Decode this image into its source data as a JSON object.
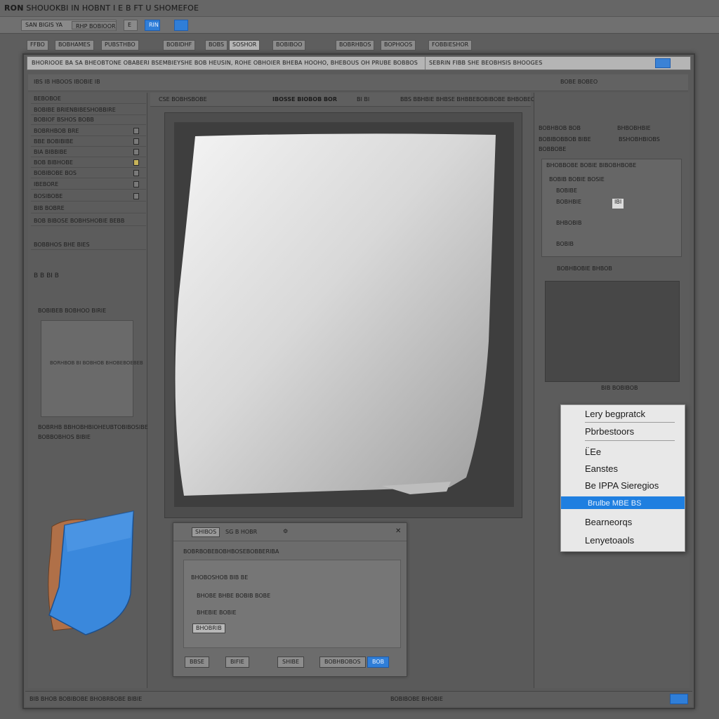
{
  "window": {
    "title_bold": "RON",
    "title_rest": "SHOUOKBI IN HOBNT I E B FT U SHOMEFOE",
    "menu_tabs": [
      "SAN BIGIS YA",
      "RHP BOBIOORE SHI",
      "E",
      "RIN",
      ""
    ]
  },
  "options_bar": {
    "buttons": [
      "FFBO",
      "BOBHAMES",
      "PUBSTHBO",
      "BOBIDHF",
      "BOBS",
      "SOSHOR",
      "BOBIBOO",
      "BOBRHBOS",
      "BOPHOOS",
      "FOBBIESHOR"
    ]
  },
  "path_bar": {
    "path": "BHORIOOE BA SA BHEOBTONE OBABERI BSEMBIEYSHE BOB HEUSIN, ROHE OBHOIER BHEBA HOOHO, BHEBOUS OH PRUBE BOBBOS",
    "path2": "SEBRIN FIBB SHE BEOBHSIS BHOOGES"
  },
  "tool_row": {
    "items": [
      "IBS  IB  HBOOS  IBOBIE  IB",
      "BOBE BOBEO"
    ]
  },
  "left_panel": {
    "rows": [
      "BEBOBOE",
      "BOBIBE BRIENBIBESHOBBIRE",
      "BOBIOF BSHOS BOBB",
      "BOBRHBOB BRE",
      "BBE BOBIBIBE",
      "BIA BIBBIBE",
      "BOB BIBHOBE",
      "BOBIBOBE  BOS",
      "IBEBORE",
      "BOSIBOBE",
      "BIB BOBRE",
      "BOB BIBOSE BOBHSHOBIE BEBB",
      "BOBBHOS BHE BIES"
    ],
    "tool_icons_label": "B  B  BI  B",
    "sub_label": "BOBIBEB BOBHOO BIRIE",
    "preview_caption": "BORHBOB BI BOBHOB BHOBEBOEBEB",
    "note_1": "BOBRHB BBHOBHBIOHEUBTOBIBOSIBE",
    "note_2": "BOBBOBHOS BIBIE"
  },
  "canvas_header": {
    "left": "CSE  BOBHSBOBE",
    "center": "IBOSSE BIOBOB BOR",
    "items": [
      "BI  BI",
      "BBS  BBHBIE  BHBSE  BHBBE",
      "BOBIBOBE BHBOBEOS"
    ]
  },
  "dialog": {
    "header_btn": "SHIBOS",
    "header_text": "SG  B  HOBR",
    "subtitle": "BOBRBOBEBOBHBOSEBOBBERIBA",
    "line_1": "BHOBOSHOB BIB BE",
    "line_2": "BHOBE BHBE BOBIB BOBE",
    "line_3": "BHEBIE BOBIE",
    "field_btn": "BHOBRIB",
    "buttons": [
      "BBSE",
      "BIFIE",
      "SHIBE",
      "BOBHBOBOS",
      "BOB"
    ]
  },
  "right_panel": {
    "row_1a": "BOBHBOB BOB",
    "row_1b": "BHBOBHBIE",
    "row_2a": "BOBIBOBBOB BIBE",
    "row_2b": "BSHOBHBIOBS",
    "row_3": "BOBBOBE",
    "section_1": "BHOBBOBE BOBIE  BIBOBHBOBE",
    "s1_rows": [
      "BOBIB  BOBIE  BOSIE",
      "BOBIBE",
      "BOBHBIE",
      "BHBOBIB",
      "BOBIB"
    ],
    "s1_badge": "IBI",
    "section_2": "BOBHBOBIE BHBOB",
    "preview_caption": "BIB  BOBIBOB"
  },
  "context_menu": {
    "items": [
      {
        "label": "Lery begpratck",
        "selected": false
      },
      {
        "label": "Pbrbestoors",
        "selected": false
      },
      {
        "label": "L̈Ee",
        "selected": false
      },
      {
        "label": "Eanstes",
        "selected": false
      },
      {
        "label": "Be IPPA Sieregios",
        "selected": false
      },
      {
        "label": "Brulbe MBE BS",
        "selected": true
      },
      {
        "label": "Bearneorqs",
        "selected": false
      },
      {
        "label": "Lenyetoaols",
        "selected": false
      }
    ]
  },
  "status_bar": {
    "left": "BIB BHOB BOBIBOBE BHOBRBOBE BIBIE",
    "right": "BOBIBOBE BHOBIE"
  },
  "colors": {
    "accent": "#1f7fe0",
    "panel": "#5c5c5c",
    "menu_bg": "#e8e8e8"
  }
}
